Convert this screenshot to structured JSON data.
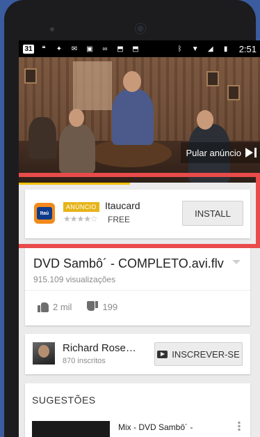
{
  "status_bar": {
    "icons": [
      "calendar-31-icon",
      "hangouts-icon",
      "twitter-icon",
      "gmail-icon",
      "image-icon",
      "voicemail-icon",
      "shopping-bag-icon",
      "shopping-bag-icon"
    ],
    "calendar_day": "31",
    "time": "2:51"
  },
  "video": {
    "skip_label": "Pular anúncio",
    "progress_fraction": 0.46
  },
  "ad": {
    "badge": "ANÚNCIO",
    "name": "Itaucard",
    "logo_text": "Itaú",
    "rating_stars": "★★★★☆",
    "price": "FREE",
    "install_label": "INSTALL"
  },
  "info": {
    "title": "DVD Sambô´ - COMPLETO.avi.flv",
    "views": "915.109 visualizações",
    "likes": "2 mil",
    "dislikes": "199"
  },
  "channel": {
    "name": "Richard Rose…",
    "subscribers": "870 inscritos",
    "subscribe_label": "INSCREVER-SE"
  },
  "suggestions": {
    "heading": "SUGESTÕES",
    "first_title": "Mix - DVD Sambô´ -"
  },
  "colors": {
    "highlight": "#e94b4b",
    "ad_badge": "#e6b418",
    "progress": "#f2c200",
    "background": "#3b5c9e"
  }
}
